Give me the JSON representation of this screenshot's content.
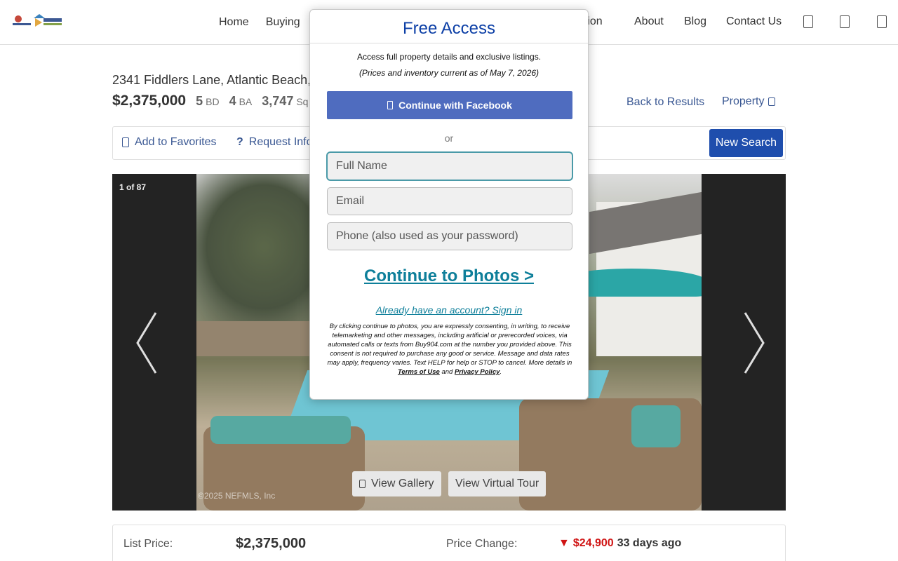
{
  "header": {
    "logo": "logo-icon",
    "nav": [
      "Home",
      "Buying",
      "",
      "ation",
      "About",
      "Blog",
      "Contact Us"
    ]
  },
  "listing": {
    "address": "2341 Fiddlers Lane, Atlantic Beach,",
    "price": "$2,375,000",
    "beds": "5",
    "beds_unit": "BD",
    "baths": "4",
    "baths_unit": "BA",
    "sqft": "3,747",
    "sqft_unit": "Sq",
    "back_link": "Back to Results",
    "property_link": "Property"
  },
  "toolbar": {
    "favorites": "Add to Favorites",
    "request_info": "Request Info",
    "new_search": "New Search"
  },
  "gallery": {
    "counter": "1 of 87",
    "copyright": "©2025 NEFMLS, Inc",
    "view_gallery": "View Gallery",
    "virtual_tour": "View Virtual Tour"
  },
  "details": {
    "list_price_label": "List Price:",
    "list_price": "$2,375,000",
    "price_change_label": "Price Change:",
    "change_arrow": "▼",
    "change_amount": "$24,900",
    "change_when": "33 days ago"
  },
  "modal": {
    "title": "Free Access",
    "intro": "Access full property details and exclusive listings.",
    "as_of": "(Prices and inventory current as of May 7, 2026)",
    "facebook": "Continue with Facebook",
    "or": "or",
    "name_placeholder": "Full Name",
    "email_placeholder": "Email",
    "phone_placeholder": "Phone (also used as your password)",
    "cta": "Continue to Photos >",
    "signin": "Already have an account? Sign in",
    "legal_pre": "By clicking continue to photos, you are expressly consenting, in writing, to receive telemarketing and other messages, including artificial or prerecorded voices, via automated calls or texts from Buy904.com at the number you provided above. This consent is not required to purchase any good or service. Message and data rates may apply, frequency varies. Text HELP for help or STOP to cancel. More details in",
    "terms": "Terms of Use",
    "and": "and",
    "privacy": "Privacy Policy",
    "period": "."
  },
  "colors": {
    "brand_blue": "#0c3fa6",
    "facebook": "#4f6cbf",
    "cta_teal": "#0e7f9a",
    "price_drop_red": "#cc0000"
  }
}
